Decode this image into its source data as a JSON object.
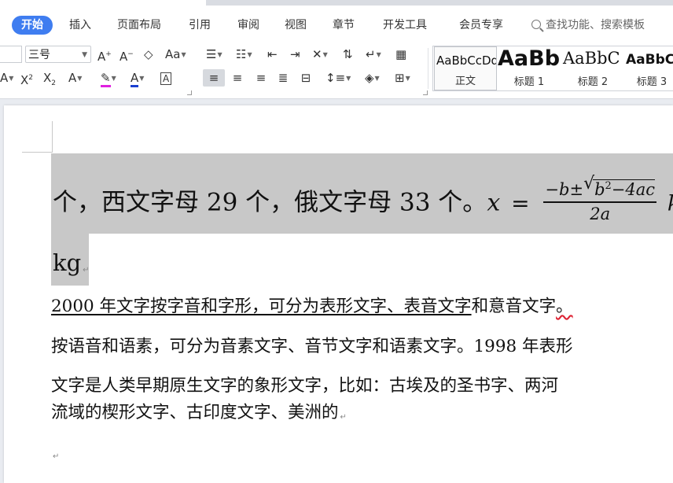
{
  "menu": {
    "tabs": [
      "开始",
      "插入",
      "页面布局",
      "引用",
      "审阅",
      "视图",
      "章节",
      "开发工具",
      "会员专享"
    ],
    "search_placeholder": "查找功能、搜索模板"
  },
  "ribbon": {
    "font_size": "三号",
    "styles": [
      {
        "sample": "AaBbCcDd",
        "name": "正文"
      },
      {
        "sample": "AaBb",
        "name": "标题 1"
      },
      {
        "sample": "AaBbC",
        "name": "标题 2"
      },
      {
        "sample": "AaBbC",
        "name": "标题 3"
      }
    ]
  },
  "document": {
    "line1_text": "个，西文字母 29 个，俄文字母 33 个。",
    "equation": {
      "lhs": "x",
      "eq": "=",
      "numerator_pre": "−b±",
      "radicand_base": "b",
      "radicand_exp": "2",
      "radicand_rest": "−4ac",
      "denominator": "2a"
    },
    "trailing_unit": "kg",
    "line2_text": "kg",
    "para1_underlined": "2000 年文字按字音和字形，可分为表形文字、表音文字",
    "para1_rest": "和意音文字",
    "para1_end": "。",
    "para2": "按语音和语素，可分为音素文字、音节文字和语素文字。1998 年表形",
    "para3_line1": "文字是人类早期原生文字的象形文字，比如：古埃及的圣书字、两河",
    "para3_line2": "流域的楔形文字、古印度文字、美洲的"
  }
}
